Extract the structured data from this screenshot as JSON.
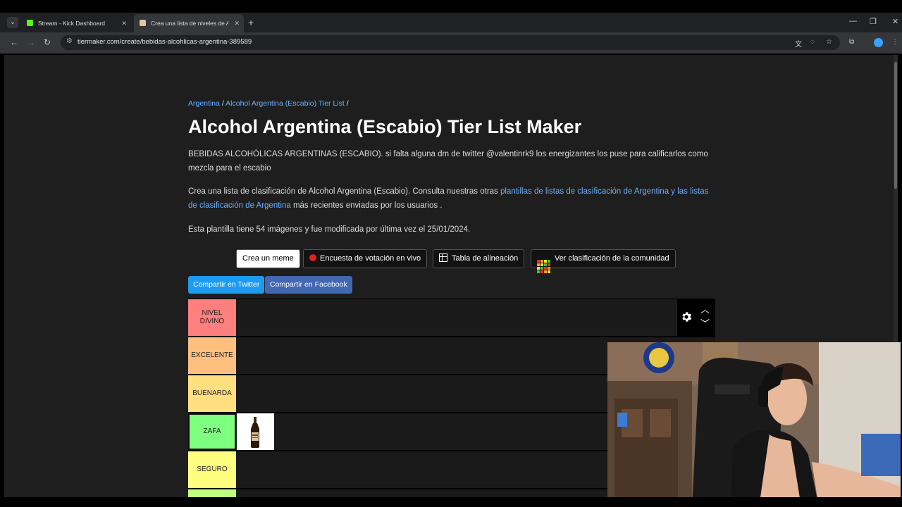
{
  "browser": {
    "tabs": [
      {
        "title": "Stream - Kick Dashboard",
        "icon": "kick-icon",
        "color": "#53fc18"
      },
      {
        "title": "Crea una lista de niveles de Alc",
        "icon": "tiermaker-icon",
        "color": "#e0e0e0"
      }
    ],
    "url": "tiermaker.com/create/bebidas-alcohlicas-argentina-389589"
  },
  "page": {
    "breadcrumb": {
      "part1": "Argentina",
      "sep1": " / ",
      "part2": "Alcohol Argentina (Escabio) Tier List",
      "sep2": " /"
    },
    "title": "Alcohol Argentina (Escabio) Tier List Maker",
    "description": "BEBIDAS ALCOHÓLICAS ARGENTINAS (ESCABIO). si falta alguna dm de twitter @valentinrk9 los energizantes los puse para calificarlos como mezcla para el escabio",
    "info_prefix": "Crea una lista de clasificación de Alcohol Argentina (Escabio). Consulta nuestras otras ",
    "info_link": "plantillas de listas de clasificación de Argentina y las listas de clasificación de Argentina",
    "info_suffix": " más recientes enviadas por los usuarios .",
    "template_info": "Esta plantilla tiene 54 imágenes y fue modificada por última vez el 25/01/2024.",
    "buttons": {
      "meme": "Crea un meme",
      "poll": "Encuesta de votación en vivo",
      "alignment": "Tabla de alineación",
      "community": "Ver clasificación de la comunidad"
    },
    "share": {
      "twitter": "Compartir en Twitter",
      "facebook": "Compartir en Facebook",
      "twitter_color": "#1d9bf0",
      "facebook_color": "#4267b2"
    },
    "tiers": [
      {
        "label": "NIVEL DIVINO",
        "color": "#ff7f7f"
      },
      {
        "label": "EXCELENTE",
        "color": "#ffbf7f"
      },
      {
        "label": "BUENARDA",
        "color": "#ffdf7f"
      },
      {
        "label": "ZAFA",
        "color": "#7fff7f"
      },
      {
        "label": "SEGURO",
        "color": "#ffff7f"
      }
    ]
  }
}
